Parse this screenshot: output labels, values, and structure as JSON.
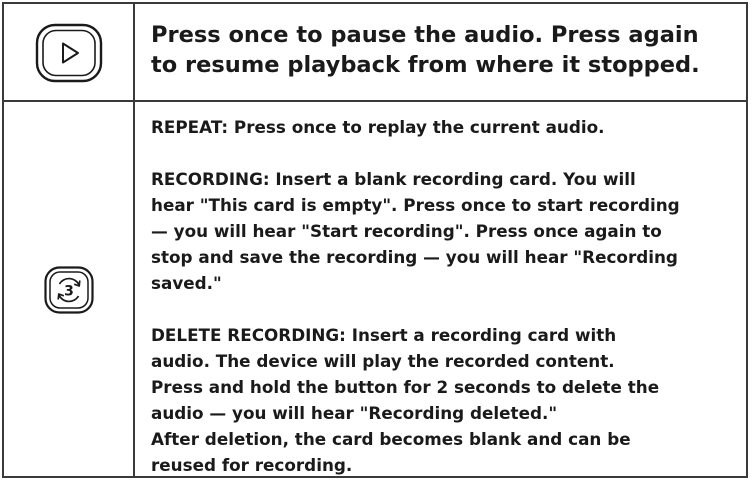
{
  "rows": [
    {
      "icon": "play-button-icon",
      "lines": [
        "Press once to pause the audio. Press again",
        "to resume playback from where it stopped."
      ]
    },
    {
      "icon": "repeat-record-button-icon",
      "icon_label": "3",
      "paragraphs": [
        {
          "lines": [
            "REPEAT: Press once to replay the current audio."
          ]
        },
        {
          "lines": [
            "RECORDING: Insert a blank recording card. You will",
            "hear \"This card is empty\". Press once to start recording",
            "— you will hear \"Start recording\". Press once again to",
            "stop and save the recording — you will hear \"Recording",
            "saved.\""
          ]
        },
        {
          "lines": [
            "DELETE RECORDING: Insert a recording card with",
            "audio. The device will play the recorded content.",
            "Press and hold the button for 2 seconds to delete the",
            "audio — you will hear \"Recording deleted.\"",
            "After deletion, the card becomes blank and can be",
            "reused for recording."
          ]
        }
      ]
    }
  ],
  "colors": {
    "border": "#3a3a3a",
    "text": "#1a1a1a"
  }
}
